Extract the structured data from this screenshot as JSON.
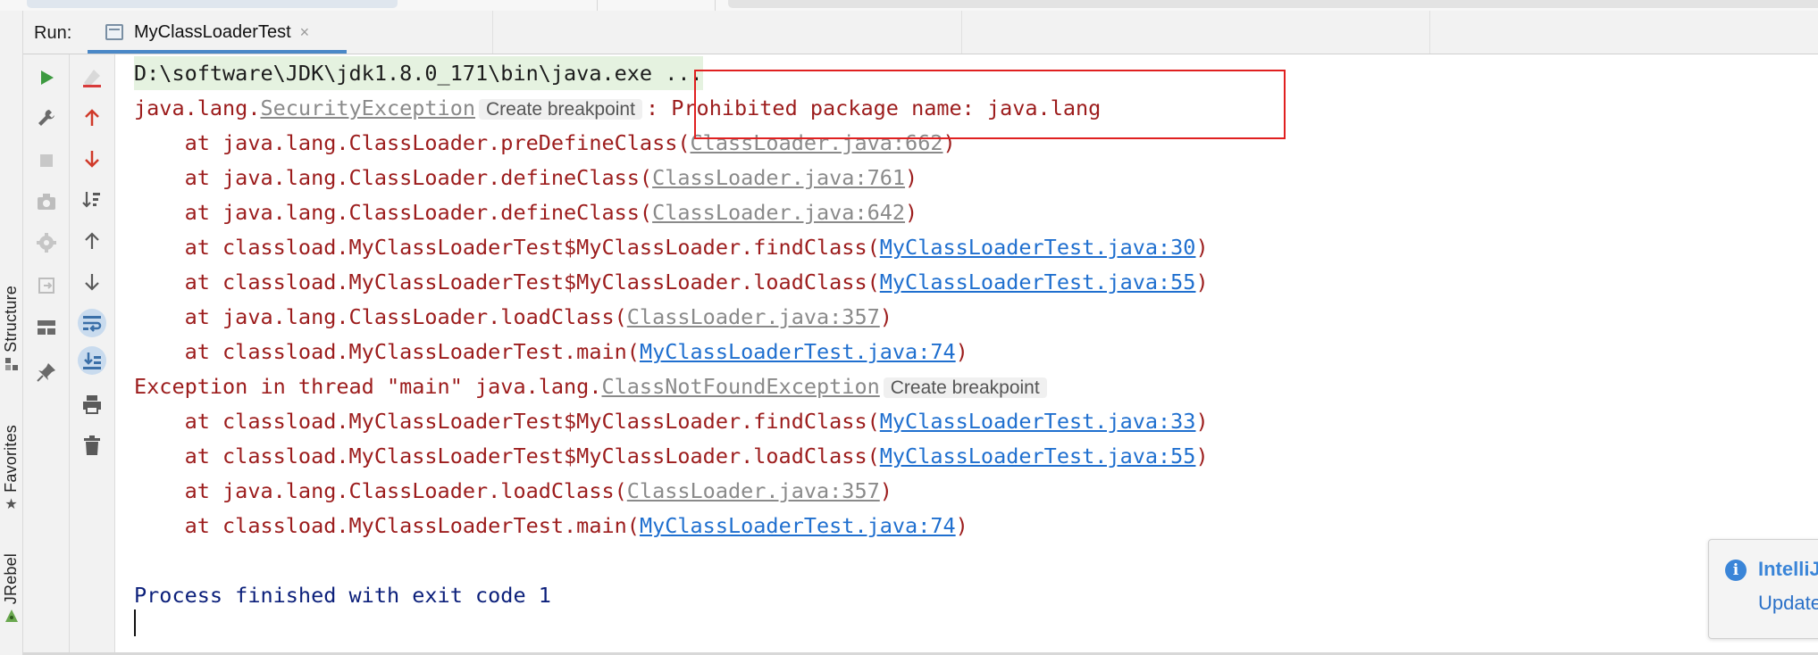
{
  "header": {
    "run_label": "Run:",
    "tab_title": "MyClassLoaderTest",
    "tab_close": "×"
  },
  "left_strip": {
    "tabs": [
      "Structure",
      "Favorites",
      "JRebel"
    ]
  },
  "console": {
    "command": "D:\\software\\JDK\\jdk1.8.0_171\\bin\\java.exe ...",
    "exc1_prefix": "java.lang.",
    "exc1_class": "SecurityException",
    "create_breakpoint": "Create breakpoint",
    "exc1_message": ": Prohibited package name: java.lang",
    "trace1": [
      {
        "prefix": "    at java.lang.ClassLoader.preDefineClass(",
        "link": "ClassLoader.java:662",
        "suffix": ")"
      },
      {
        "prefix": "    at java.lang.ClassLoader.defineClass(",
        "link": "ClassLoader.java:761",
        "suffix": ")"
      },
      {
        "prefix": "    at java.lang.ClassLoader.defineClass(",
        "link": "ClassLoader.java:642",
        "suffix": ")"
      },
      {
        "prefix": "    at classload.MyClassLoaderTest$MyClassLoader.findClass(",
        "link": "MyClassLoaderTest.java:30",
        "suffix": ")"
      },
      {
        "prefix": "    at classload.MyClassLoaderTest$MyClassLoader.loadClass(",
        "link": "MyClassLoaderTest.java:55",
        "suffix": ")"
      },
      {
        "prefix": "    at java.lang.ClassLoader.loadClass(",
        "link": "ClassLoader.java:357",
        "suffix": ")"
      },
      {
        "prefix": "    at classload.MyClassLoaderTest.main(",
        "link": "MyClassLoaderTest.java:74",
        "suffix": ")"
      }
    ],
    "exc2_prefix": "Exception in thread \"main\" java.lang.",
    "exc2_class": "ClassNotFoundException",
    "trace2": [
      {
        "prefix": "    at classload.MyClassLoaderTest$MyClassLoader.findClass(",
        "link": "MyClassLoaderTest.java:33",
        "suffix": ")"
      },
      {
        "prefix": "    at classload.MyClassLoaderTest$MyClassLoader.loadClass(",
        "link": "MyClassLoaderTest.java:55",
        "suffix": ")"
      },
      {
        "prefix": "    at java.lang.ClassLoader.loadClass(",
        "link": "ClassLoader.java:357",
        "suffix": ")"
      },
      {
        "prefix": "    at classload.MyClassLoaderTest.main(",
        "link": "MyClassLoaderTest.java:74",
        "suffix": ")"
      }
    ],
    "exit_message": "Process finished with exit code 1"
  },
  "notification": {
    "title": "IntelliJ",
    "action": "Update"
  },
  "colors": {
    "error_text": "#9c1c1c",
    "link_blue": "#1f6fcf",
    "highlight_box": "#e02020",
    "exit_text": "#0b1f7a"
  }
}
